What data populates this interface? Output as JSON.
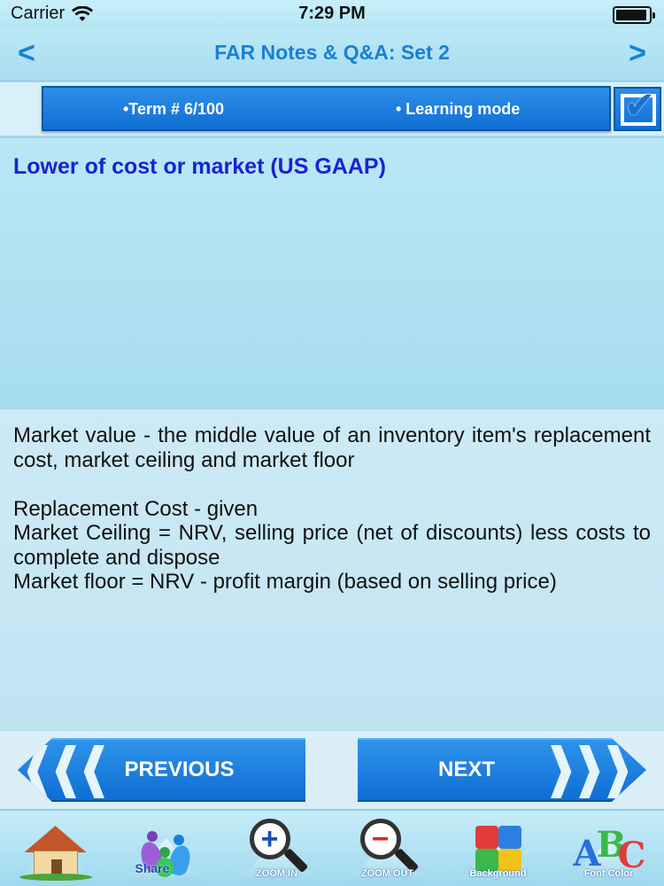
{
  "status_bar": {
    "carrier": "Carrier",
    "time": "7:29 PM",
    "wifi_icon": "wifi-icon",
    "battery_icon": "battery-icon"
  },
  "nav": {
    "title": "FAR Notes & Q&A: Set 2",
    "prev_arrow": "<",
    "next_arrow": ">"
  },
  "term_bar": {
    "term": "•Term #  6/100",
    "mode": "• Learning mode",
    "checked": true
  },
  "term_title": "Lower of cost or market (US GAAP)",
  "definition": {
    "line1": "Market value - the middle value of an inventory item's replacement cost, market ceiling and market floor",
    "line2": "Replacement Cost - given",
    "line3": "Market Ceiling = NRV, selling price (net of discounts) less costs to complete and dispose",
    "line4": "Market floor = NRV - profit margin (based on selling price)"
  },
  "buttons": {
    "previous": "PREVIOUS",
    "next": "NEXT"
  },
  "toolbar": {
    "home_icon": "home-icon",
    "share_label": "Share",
    "zoom_in_label": "ZOOM IN",
    "zoom_out_label": "ZOOM OUT",
    "puzzle_label": "Background",
    "abc_label": "Font Color"
  },
  "colors": {
    "accent_blue": "#1a7fd6",
    "title_blue": "#1a21d6",
    "button_blue": "#0f6ed4"
  }
}
